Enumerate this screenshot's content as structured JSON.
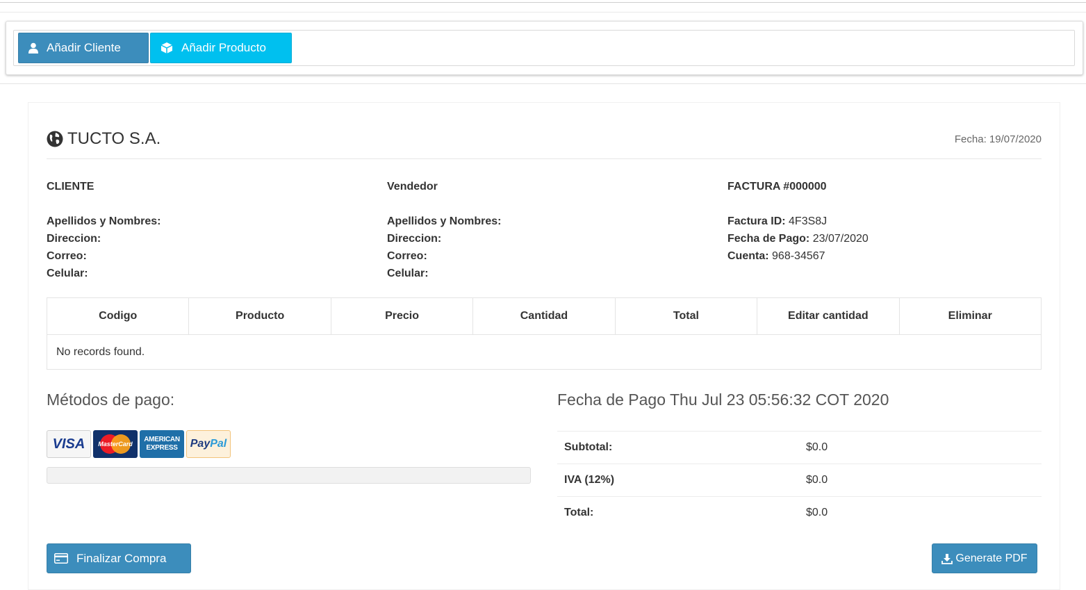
{
  "toolbar": {
    "add_client_label": "Añadir Cliente",
    "add_product_label": "Añadir Producto"
  },
  "invoice": {
    "company": "TUCTO S.A.",
    "date": "Fecha: 19/07/2020",
    "cliente": {
      "heading": "CLIENTE",
      "nombres_label": "Apellidos y Nombres:",
      "direccion_label": "Direccion:",
      "correo_label": "Correo:",
      "celular_label": "Celular:"
    },
    "vendedor": {
      "heading": "Vendedor",
      "nombres_label": "Apellidos y Nombres:",
      "direccion_label": "Direccion:",
      "correo_label": "Correo:",
      "celular_label": "Celular:"
    },
    "factura": {
      "heading": "FACTURA #000000",
      "id_label": "Factura ID:",
      "id_value": "4F3S8J",
      "fecha_pago_label": "Fecha de Pago:",
      "fecha_pago_value": "23/07/2020",
      "cuenta_label": "Cuenta:",
      "cuenta_value": "968-34567"
    }
  },
  "table": {
    "headers": [
      "Codigo",
      "Producto",
      "Precio",
      "Cantidad",
      "Total",
      "Editar cantidad",
      "Eliminar"
    ],
    "empty_message": "No records found."
  },
  "payment": {
    "title": "Métodos de pago:",
    "cards": {
      "visa": "VISA",
      "mastercard": "MasterCard",
      "amex_line1": "AMERICAN",
      "amex_line2": "EXPRESS",
      "paypal_a": "Pay",
      "paypal_b": "Pal"
    },
    "progress_fraction": 0
  },
  "totals": {
    "fecha_pago": "Fecha de Pago Thu Jul 23 05:56:32 COT 2020",
    "subtotal_label": "Subtotal:",
    "subtotal_value": "$0.0",
    "iva_label": "IVA (12%)",
    "iva_value": "$0.0",
    "total_label": "Total:",
    "total_value": "$0.0"
  },
  "actions": {
    "finalizar_label": "Finalizar Compra",
    "pdf_label": "Generate PDF"
  },
  "colors": {
    "primary": "#3c8dbc",
    "info": "#00c0ef"
  }
}
